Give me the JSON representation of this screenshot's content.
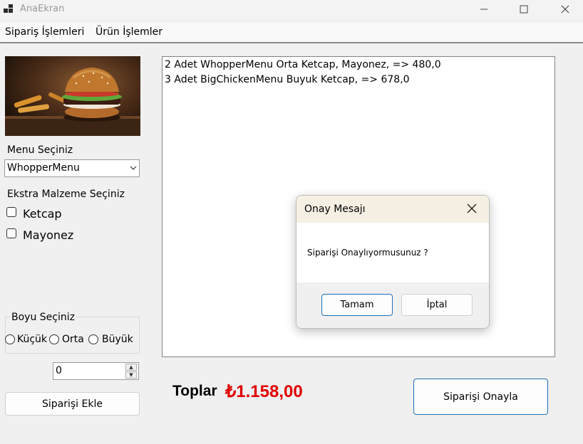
{
  "window": {
    "title": "AnaEkran"
  },
  "menu": {
    "items": [
      "Sipariş İşlemleri",
      "Ürün İşlemler"
    ]
  },
  "left": {
    "menu_label": "Menu Seçiniz",
    "menu_selected": "WhopperMenu",
    "extras_label": "Ekstra Malzeme Seçiniz",
    "extras": [
      {
        "label": "Ketcap",
        "checked": false
      },
      {
        "label": "Mayonez",
        "checked": false
      }
    ],
    "size_label": "Boyu Seçiniz",
    "sizes": [
      "Küçük",
      "Orta",
      "Büyük"
    ],
    "quantity": "0",
    "add_button": "Siparişi Ekle"
  },
  "orders": [
    "2 Adet WhopperMenu Orta Ketcap, Mayonez,  => 480,0",
    "3 Adet BigChickenMenu Buyuk Ketcap,  => 678,0"
  ],
  "total": {
    "label": "Toplar",
    "value": "₺1.158,00",
    "color": "#e00000"
  },
  "confirm_button": "Siparişi Onayla",
  "dialog": {
    "title": "Onay Mesajı",
    "message": "Siparişi Onaylıyormusunuz ?",
    "ok": "Tamam",
    "cancel": "İptal"
  },
  "icons": {
    "close": "close-icon",
    "minimize": "minimize-icon",
    "maximize": "maximize-icon",
    "dropdown": "chevron-down-icon"
  }
}
